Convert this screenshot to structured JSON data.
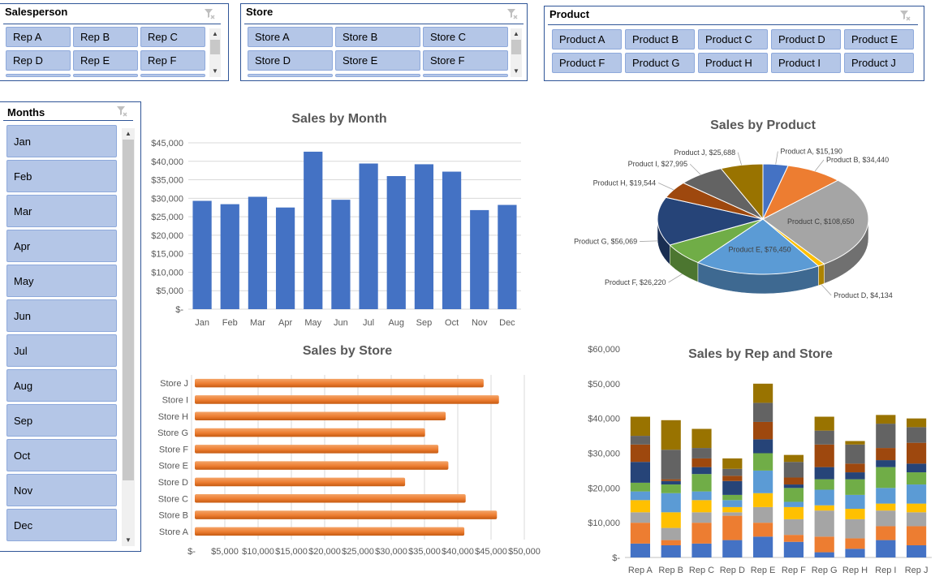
{
  "slicers": {
    "salesperson": {
      "title": "Salesperson",
      "items": [
        "Rep A",
        "Rep B",
        "Rep C",
        "Rep D",
        "Rep E",
        "Rep F"
      ]
    },
    "store": {
      "title": "Store",
      "items": [
        "Store A",
        "Store B",
        "Store C",
        "Store D",
        "Store E",
        "Store F"
      ]
    },
    "product": {
      "title": "Product",
      "items": [
        "Product A",
        "Product B",
        "Product C",
        "Product D",
        "Product E",
        "Product F",
        "Product G",
        "Product H",
        "Product I",
        "Product J"
      ]
    },
    "months": {
      "title": "Months",
      "items": [
        "Jan",
        "Feb",
        "Mar",
        "Apr",
        "May",
        "Jun",
        "Jul",
        "Aug",
        "Sep",
        "Oct",
        "Nov",
        "Dec"
      ]
    }
  },
  "icons": {
    "clear_filter": "clear-filter-icon",
    "scroll_up": "scroll-up-icon",
    "scroll_down": "scroll-down-icon"
  },
  "chart_data": [
    {
      "id": "month",
      "type": "bar",
      "title": "Sales by Month",
      "categories": [
        "Jan",
        "Feb",
        "Mar",
        "Apr",
        "May",
        "Jun",
        "Jul",
        "Aug",
        "Sep",
        "Oct",
        "Nov",
        "Dec"
      ],
      "values": [
        29300,
        28400,
        30400,
        27500,
        42600,
        29600,
        39400,
        36000,
        39200,
        37200,
        26800,
        28200
      ],
      "ylim": [
        0,
        45000
      ],
      "yticks": [
        "$-",
        "$5,000",
        "$10,000",
        "$15,000",
        "$20,000",
        "$25,000",
        "$30,000",
        "$35,000",
        "$40,000",
        "$45,000"
      ],
      "color": "#4472c4",
      "grid": true
    },
    {
      "id": "store",
      "type": "bar",
      "orientation": "horizontal",
      "title": "Sales by Store",
      "categories": [
        "Store A",
        "Store B",
        "Store C",
        "Store D",
        "Store E",
        "Store F",
        "Store G",
        "Store H",
        "Store I",
        "Store J"
      ],
      "values": [
        40500,
        45400,
        40700,
        31600,
        38100,
        36600,
        34600,
        37700,
        45700,
        43400
      ],
      "xlim": [
        0,
        50000
      ],
      "xticks": [
        "$-",
        "$5,000",
        "$10,000",
        "$15,000",
        "$20,000",
        "$25,000",
        "$30,000",
        "$35,000",
        "$40,000",
        "$45,000",
        "$50,000"
      ],
      "color": "#ed7d31",
      "grid": true
    },
    {
      "id": "product",
      "type": "pie",
      "title": "Sales by Product",
      "labels": [
        "Product A",
        "Product B",
        "Product C",
        "Product D",
        "Product E",
        "Product F",
        "Product G",
        "Product H",
        "Product I",
        "Product J"
      ],
      "values": [
        15190,
        34440,
        108650,
        4134,
        76450,
        26220,
        56069,
        19544,
        27995,
        25688
      ],
      "value_labels": [
        "$15,190",
        "$34,440",
        "$108,650",
        "$4,134",
        "$76,450",
        "$26,220",
        "$56,069",
        "$19,544",
        "$27,995",
        "$25,688"
      ],
      "colors": [
        "#4472c4",
        "#ed7d31",
        "#a5a5a5",
        "#ffc000",
        "#5b9bd5",
        "#70ad47",
        "#264478",
        "#9e480e",
        "#636363",
        "#997300"
      ],
      "three_d": true
    },
    {
      "id": "rep_store",
      "type": "bar",
      "stacked": true,
      "title": "Sales by Rep and Store",
      "categories": [
        "Rep A",
        "Rep B",
        "Rep C",
        "Rep D",
        "Rep E",
        "Rep F",
        "Rep G",
        "Rep H",
        "Rep I",
        "Rep J"
      ],
      "ylim": [
        0,
        60000
      ],
      "yticks": [
        "$-",
        "$10,000",
        "$20,000",
        "$30,000",
        "$40,000",
        "$50,000",
        "$60,000"
      ],
      "series": [
        {
          "color": "#4472c4",
          "values": [
            4000,
            3500,
            4000,
            5000,
            6000,
            4500,
            1500,
            2500,
            5000,
            3500
          ]
        },
        {
          "color": "#ed7d31",
          "values": [
            6000,
            1500,
            6000,
            7000,
            4000,
            2000,
            4500,
            3000,
            4000,
            5500
          ]
        },
        {
          "color": "#a5a5a5",
          "values": [
            3000,
            3500,
            3000,
            1000,
            4500,
            4500,
            7500,
            5500,
            4500,
            4000
          ]
        },
        {
          "color": "#ffc000",
          "values": [
            3500,
            4500,
            3500,
            1500,
            4000,
            3500,
            1500,
            3000,
            2000,
            2500
          ]
        },
        {
          "color": "#5b9bd5",
          "values": [
            2500,
            5500,
            2500,
            2000,
            6500,
            1500,
            4500,
            4000,
            4500,
            5500
          ]
        },
        {
          "color": "#70ad47",
          "values": [
            2500,
            2500,
            5000,
            1500,
            5000,
            4000,
            3000,
            4500,
            6000,
            3500
          ]
        },
        {
          "color": "#264478",
          "values": [
            6000,
            1000,
            2000,
            4000,
            4000,
            1000,
            3500,
            2000,
            2000,
            2500
          ]
        },
        {
          "color": "#9e480e",
          "values": [
            5000,
            500,
            2500,
            1500,
            5000,
            2000,
            6500,
            2500,
            3500,
            6000
          ]
        },
        {
          "color": "#636363",
          "values": [
            2500,
            8500,
            3000,
            2000,
            5500,
            4500,
            4000,
            5500,
            7000,
            4500
          ]
        },
        {
          "color": "#997300",
          "values": [
            5500,
            8500,
            5500,
            3000,
            5500,
            2000,
            4000,
            1000,
            2500,
            2500
          ]
        }
      ]
    }
  ]
}
